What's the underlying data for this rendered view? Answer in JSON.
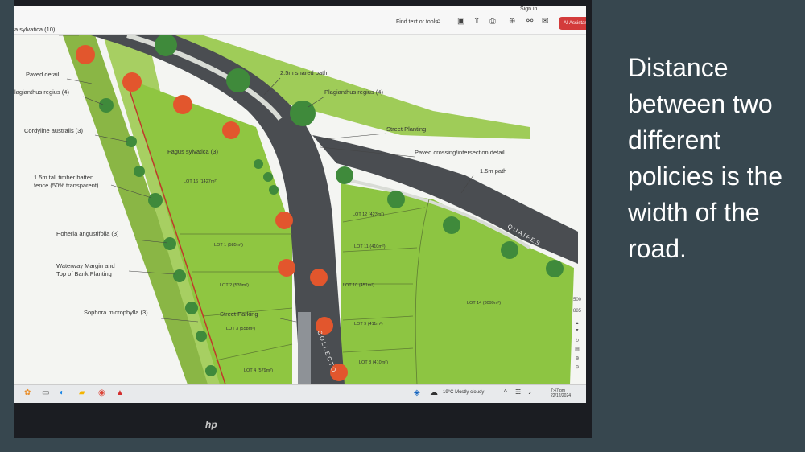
{
  "caption": "Distance between two different policies is the width of the road.",
  "toolbar": {
    "find_label": "Find text or tools",
    "signin_label": "Sign in",
    "ai_label": "AI Assistant"
  },
  "map_labels": {
    "sylvatica_top": "a sylvatica (10)",
    "paved_detail": "Paved detail",
    "plagianthus_left": "lagianthus regius (4)",
    "cordyline": "Cordyline australis (3)",
    "fence_1": "1.5m tall timber batten",
    "fence_2": "fence (50% transparent)",
    "hoheria": "Hoheria angustifolia (3)",
    "waterway_1": "Waterway Margin and",
    "waterway_2": "Top of Bank Planting",
    "sophora": "Sophora microphylla (3)",
    "shared_path": "2.5m shared path",
    "plagianthus_right": "Plagianthus regius (4)",
    "street_planting": "Street Planting",
    "paved_crossing": "Paved crossing/intersection detail",
    "path_1_5m": "1.5m path",
    "fagus": "Fagus sylvatica (3)",
    "street_parking": "Street Parking",
    "road_quaifes": "QUAIFES",
    "road_collector": "COLLECTO"
  },
  "lots": {
    "lot16": "LOT 16 (1427m²)",
    "lot1": "LOT 1 (585m²)",
    "lot2": "LOT 2 (539m²)",
    "lot3": "LOT 3 (558m²)",
    "lot4": "LOT 4 (579m²)",
    "lot12": "LOT 12 (423m²)",
    "lot11": "LOT 11 (410m²)",
    "lot10": "LOT 10 (451m²)",
    "lot9": "LOT 9 (411m²)",
    "lot8": "LOT 8 (410m²)",
    "lot14": "LOT 14 (3099m²)"
  },
  "side_panel": {
    "zoom_top": "500",
    "zoom_bottom": "885"
  },
  "taskbar": {
    "weather": "19°C  Mostly cloudy",
    "time": "7:47 pm",
    "date": "22/12/2024"
  },
  "bezel_logo": "hp",
  "colors": {
    "slide_bg": "#37474f",
    "lawn": "#8cc63f",
    "road": "#4a4d51",
    "ai_button": "#d33b3b"
  }
}
